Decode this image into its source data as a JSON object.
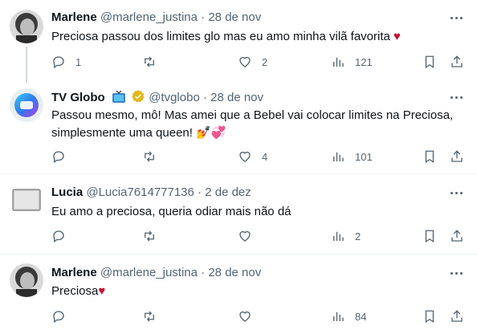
{
  "tweets": [
    {
      "name": "Marlene",
      "handle": "@marlene_justina",
      "separator": "·",
      "date": "28 de nov",
      "text": "Preciosa passou dos limites glo mas eu amo minha vilã favorita",
      "emoji": "♥",
      "replies": "1",
      "retweets": "",
      "likes": "2",
      "views": "121"
    },
    {
      "name": "TV Globo",
      "handle": "@tvglobo",
      "separator": "·",
      "date": "28 de nov",
      "text_line1": "Passou mesmo, mô! Mas amei que a Bebel vai colocar limites na Preciosa,",
      "text_line2": "simplesmente uma queen! 💅💞",
      "replies": "",
      "retweets": "",
      "likes": "4",
      "views": "101"
    },
    {
      "name": "Lucia",
      "handle": "@Lucia7614777136",
      "separator": "·",
      "date": "2 de dez",
      "text": "Eu amo a preciosa, queria odiar mais não dá",
      "replies": "",
      "retweets": "",
      "likes": "",
      "views": "2"
    },
    {
      "name": "Marlene",
      "handle": "@marlene_justina",
      "separator": "·",
      "date": "28 de nov",
      "text": "Preciosa",
      "emoji": "♥",
      "replies": "",
      "retweets": "",
      "likes": "",
      "views": "84"
    }
  ],
  "icons": [
    "reply-icon",
    "retweet-icon",
    "like-icon",
    "views-icon",
    "bookmark-icon",
    "share-icon",
    "more-icon",
    "verified-icon",
    "tv-emoji-icon"
  ],
  "colors": {
    "text": "#0f1419",
    "secondary": "#536471",
    "verified": "#e2b719",
    "heart": "#c8102e",
    "divider": "#eff3f4"
  }
}
